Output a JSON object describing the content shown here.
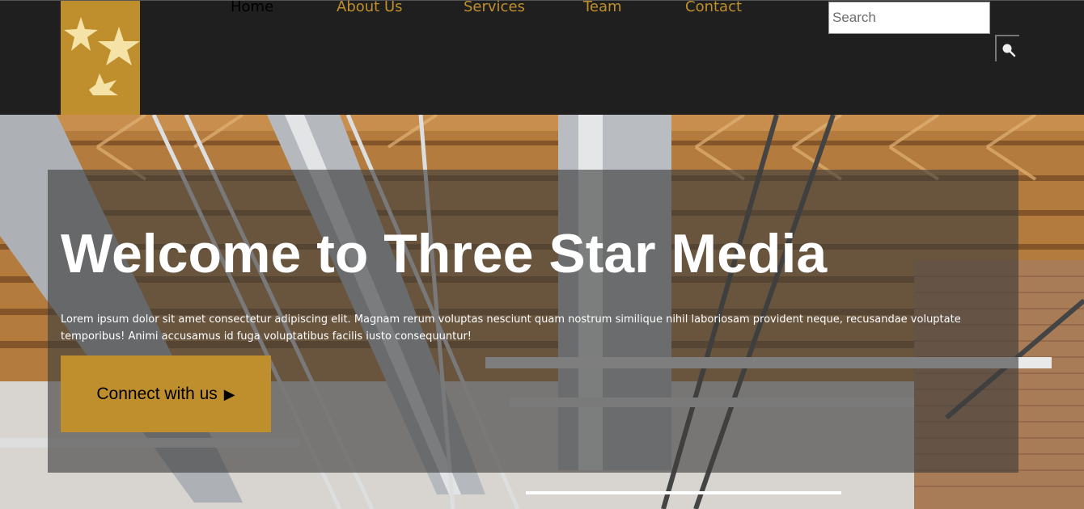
{
  "brand": {
    "logo_icon": "three-stars-icon",
    "accent_color": "#bf8f2e",
    "header_bg": "#1f1f1f"
  },
  "nav": {
    "items": [
      {
        "label": "Home",
        "active": true
      },
      {
        "label": "About Us",
        "active": false
      },
      {
        "label": "Services",
        "active": false
      },
      {
        "label": "Team",
        "active": false
      },
      {
        "label": "Contact",
        "active": false
      }
    ]
  },
  "search": {
    "placeholder": "Search",
    "button_icon": "search-icon"
  },
  "hero": {
    "title": "Welcome to Three Star Media",
    "text": "Lorem ipsum dolor sit amet consectetur adipiscing elit. Magnam rerum voluptas nesciunt quam nostrum similique nihil laboriosam provident neque, recusandae voluptate temporibus! Animi accusamus id fuga voluptatibus facilis iusto consequuntur!",
    "cta_label": "Connect with us",
    "cta_icon": "play-arrow-icon",
    "background_image": "industrial-ceiling-photo"
  }
}
